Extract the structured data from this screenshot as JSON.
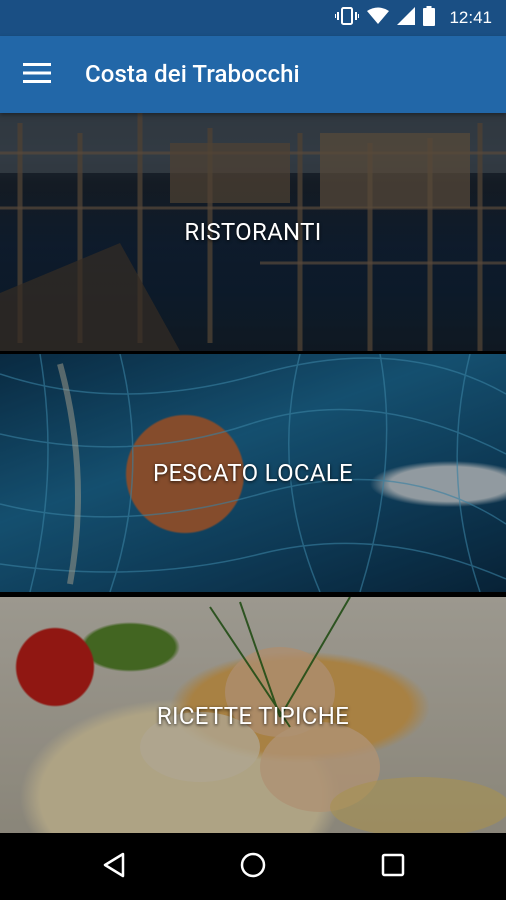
{
  "status_bar": {
    "time": "12:41",
    "icons": [
      "vibrate-icon",
      "wifi-icon",
      "signal-icon",
      "battery-icon"
    ]
  },
  "app_bar": {
    "title": "Costa dei Trabocchi",
    "menu_icon": "menu-icon",
    "color": "#2267a8"
  },
  "cards": [
    {
      "label": "RISTORANTI"
    },
    {
      "label": "PESCATO LOCALE"
    },
    {
      "label": "RICETTE TIPICHE"
    }
  ],
  "nav_bar": {
    "buttons": [
      "back-icon",
      "home-icon",
      "recents-icon"
    ]
  }
}
